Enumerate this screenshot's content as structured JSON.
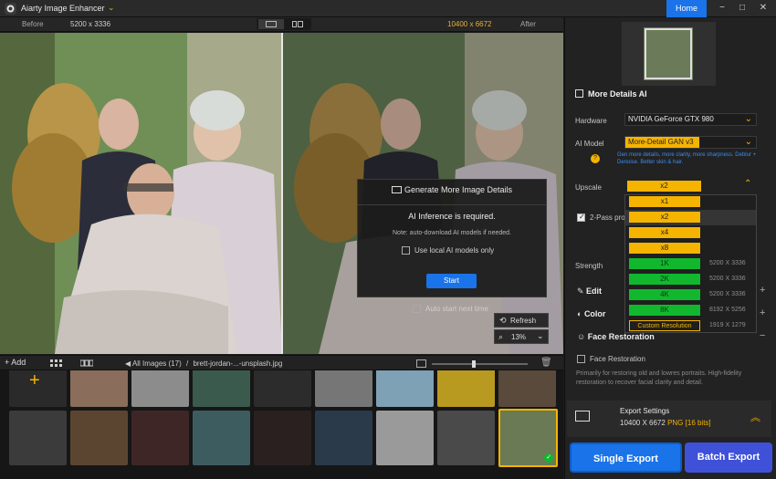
{
  "app": {
    "title": "Aiarty Image Enhancer",
    "home_label": "Home"
  },
  "window_controls": [
    "−",
    "□",
    "✕"
  ],
  "compare": {
    "before_label": "Before",
    "before_resolution": "5200 x 3336",
    "after_resolution": "10400 x 6672",
    "after_label": "After"
  },
  "modal": {
    "title": "Generate More Image Details",
    "required": "AI Inference is required.",
    "note": "Note: auto-download AI models if needed.",
    "local_models": "Use local AI models only",
    "start": "Start"
  },
  "auto_start": "Auto start next time",
  "refresh": "Refresh",
  "zoom": "13%",
  "thumbbar": {
    "add": "Add",
    "all_images": "All Images (17)",
    "separator": "/",
    "filename": "brett-jordan-...-unsplash.jpg"
  },
  "panel": {
    "section": "More Details AI",
    "hardware_label": "Hardware",
    "hardware_value": "NVIDIA GeForce GTX 980",
    "model_label": "AI Model",
    "model_value": "More-Detail GAN  v3",
    "model_hint": "Gen more details, more clarity, more sharpness. Deblur + Denoise. Better skin & hair.",
    "upscale_label": "Upscale",
    "upscale_value": "x2",
    "two_pass": "2-Pass proc",
    "strength": "Strength",
    "edit": "Edit",
    "color": "Color",
    "face_restoration_title": "Face Restoration",
    "face_restoration_cb": "Face Restoration",
    "face_desc": "Primarily for restoring old and lowres portraits. High-fidelity restoration to recover facial clarity and detail.",
    "export_title": "Export Settings",
    "export_res": "10400 X 6672",
    "export_fmt": "PNG",
    "export_bits": "[16 bits]",
    "single_export": "Single Export",
    "batch_export": "Batch Export"
  },
  "dropdown": {
    "items": [
      {
        "label": "x1",
        "res": ""
      },
      {
        "label": "x2",
        "res": ""
      },
      {
        "label": "x4",
        "res": ""
      },
      {
        "label": "x8",
        "res": ""
      },
      {
        "label": "1K",
        "res": "5200 X 3336"
      },
      {
        "label": "2K",
        "res": "5200 X 3336"
      },
      {
        "label": "4K",
        "res": "5200 X 3336"
      },
      {
        "label": "8K",
        "res": "8192 X 5256"
      },
      {
        "label": "Custom Resolution",
        "res": "1919 X 1279"
      }
    ]
  },
  "colors": {
    "accent": "#1a73e8",
    "highlight": "#f5b400",
    "green": "#11b82e"
  }
}
